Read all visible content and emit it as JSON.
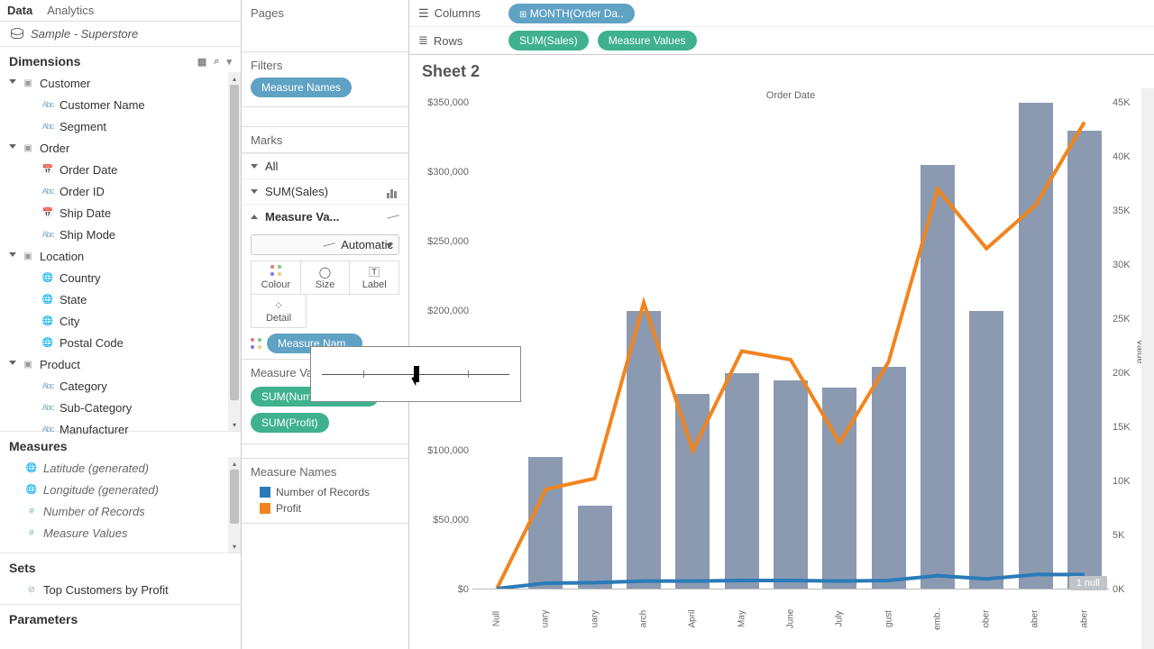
{
  "tabs": {
    "data": "Data",
    "analytics": "Analytics"
  },
  "datasource": "Sample - Superstore",
  "dimensions": {
    "title": "Dimensions",
    "groups": [
      {
        "name": "Customer",
        "items": [
          {
            "icon": "abc",
            "name": "Customer Name"
          },
          {
            "icon": "abc",
            "name": "Segment"
          }
        ]
      },
      {
        "name": "Order",
        "items": [
          {
            "icon": "date",
            "name": "Order Date"
          },
          {
            "icon": "abc",
            "name": "Order ID"
          },
          {
            "icon": "date",
            "name": "Ship Date"
          },
          {
            "icon": "abc",
            "name": "Ship Mode"
          }
        ]
      },
      {
        "name": "Location",
        "items": [
          {
            "icon": "geo",
            "name": "Country"
          },
          {
            "icon": "geo",
            "name": "State"
          },
          {
            "icon": "geo",
            "name": "City"
          },
          {
            "icon": "geo",
            "name": "Postal Code"
          }
        ]
      },
      {
        "name": "Product",
        "items": [
          {
            "icon": "abc",
            "name": "Category"
          },
          {
            "icon": "abc",
            "name": "Sub-Category"
          },
          {
            "icon": "abc",
            "name": "Manufacturer"
          }
        ]
      }
    ]
  },
  "measures": {
    "title": "Measures",
    "items": [
      {
        "icon": "geo",
        "name": "Latitude (generated)"
      },
      {
        "icon": "geo",
        "name": "Longitude (generated)"
      },
      {
        "icon": "num",
        "name": "Number of Records"
      },
      {
        "icon": "num",
        "name": "Measure Values"
      }
    ]
  },
  "sets": {
    "title": "Sets",
    "items": [
      {
        "name": "Top Customers by Profit"
      }
    ]
  },
  "parameters": {
    "title": "Parameters"
  },
  "mid": {
    "pages": "Pages",
    "filters": {
      "title": "Filters",
      "pill": "Measure Names"
    },
    "marks": {
      "title": "Marks",
      "all": "All",
      "sum_sales": "SUM(Sales)",
      "measure_values": "Measure Va...",
      "select": "Automatic",
      "btns": {
        "colour": "Colour",
        "size": "Size",
        "label": "Label",
        "detail": "Detail"
      },
      "colour_pill": "Measure Nam.."
    },
    "measure_values": {
      "title": "Measure Values",
      "pills": [
        "SUM(Number of Rec..",
        "SUM(Profit)"
      ]
    },
    "measure_names": {
      "title": "Measure Names",
      "items": [
        {
          "colour": "#2a7ab9",
          "name": "Number of Records"
        },
        {
          "colour": "#f2841e",
          "name": "Profit"
        }
      ]
    }
  },
  "shelves": {
    "columns": {
      "label": "Columns",
      "pill": "MONTH(Order Da.."
    },
    "rows": {
      "label": "Rows",
      "pills": [
        "SUM(Sales)",
        "Measure Values"
      ]
    }
  },
  "sheet_title": "Sheet 2",
  "axis_title_top": "Order Date",
  "y2_label": "Value",
  "null_badge": "1 null",
  "chart_data": {
    "type": "bar+line",
    "categories": [
      "Null",
      "January",
      "February",
      "March",
      "April",
      "May",
      "June",
      "July",
      "August",
      "September",
      "October",
      "November",
      "December"
    ],
    "bars": {
      "name": "Sales",
      "axis": "left",
      "values": [
        0,
        95000,
        60000,
        200000,
        140000,
        155000,
        150000,
        145000,
        160000,
        305000,
        200000,
        350000,
        330000
      ]
    },
    "series": [
      {
        "name": "Profit",
        "axis": "right",
        "colour": "#f2841e",
        "values": [
          0,
          9200,
          10200,
          26500,
          12800,
          22000,
          21200,
          13500,
          21000,
          37000,
          31500,
          35500,
          43200
        ]
      },
      {
        "name": "Number of Records",
        "axis": "right",
        "colour": "#2a7ab9",
        "values": [
          0,
          500,
          550,
          700,
          700,
          750,
          750,
          700,
          750,
          1200,
          900,
          1300,
          1300
        ]
      }
    ],
    "y_left": {
      "min": 0,
      "max": 350000,
      "ticks": [
        "$0",
        "$50,000",
        "$100,000",
        "$150,000",
        "$200,000",
        "$250,000",
        "$300,000",
        "$350,000"
      ]
    },
    "y_right": {
      "min": 0,
      "max": 45000,
      "ticks": [
        "0K",
        "5K",
        "10K",
        "15K",
        "20K",
        "25K",
        "30K",
        "35K",
        "40K",
        "45K"
      ]
    },
    "x_truncated": [
      "Null",
      "uary",
      "uary",
      "arch",
      "April",
      "May",
      "June",
      "July",
      "gust",
      "emb..",
      "ober",
      "aber",
      "aber"
    ]
  }
}
